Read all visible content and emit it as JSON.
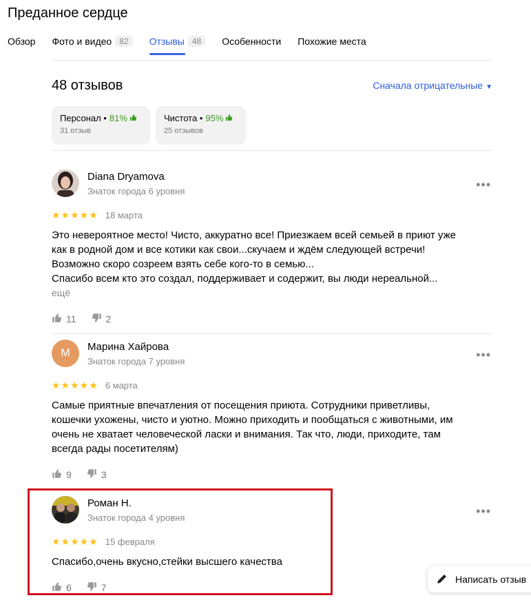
{
  "place": {
    "title": "Преданное сердце"
  },
  "tabs": [
    {
      "label": "Обзор",
      "count": ""
    },
    {
      "label": "Фото и видео",
      "count": "82"
    },
    {
      "label": "Отзывы",
      "count": "48"
    },
    {
      "label": "Особенности",
      "count": ""
    },
    {
      "label": "Похожие места",
      "count": ""
    }
  ],
  "reviews_header": {
    "count_label": "48 отзывов",
    "sort_label": "Сначала отрицательные"
  },
  "aspects": [
    {
      "name": "Персонал",
      "percent": "81%",
      "sub": "31 отзыв"
    },
    {
      "name": "Чистота",
      "percent": "95%",
      "sub": "25 отзывов"
    }
  ],
  "reviews": [
    {
      "author": "Diana Dryamova",
      "level": "Знаток города 6 уровня",
      "stars": "★★★★★",
      "date": "18 марта",
      "text_lines": [
        "Это невероятное место! Чисто, аккуратно все! Приезжаем всей семьей в приют уже",
        "как в родной дом и все котики как свои...скучаем и ждём следующей встречи!",
        "Возможно скоро созреем взять себе кого-то в семью...",
        "Спасибо всем кто это создал, поддерживает и содержит, вы люди нереальной..."
      ],
      "more_label": "ещё",
      "likes": "11",
      "dislikes": "2"
    },
    {
      "author": "Марина Хайрова",
      "avatar_letter": "М",
      "level": "Знаток города 7 уровня",
      "stars": "★★★★★",
      "date": "6 марта",
      "text_lines": [
        "Самые приятные впечатления от посещения приюта. Сотрудники приветливы,",
        "кошечки ухожены, чисто и уютно. Можно приходить и пообщаться с животными, им",
        "очень не хватает человеческой ласки и внимания. Так что, люди, приходите, там",
        "всегда рады посетителям)"
      ],
      "likes": "9",
      "dislikes": "3"
    },
    {
      "author": "Роман Н.",
      "level": "Знаток города 4 уровня",
      "stars": "★★★★★",
      "date": "15 февраля",
      "text_lines": [
        "Спасибо,очень вкусно,стейки высшего качества"
      ],
      "likes": "6",
      "dislikes": "7"
    }
  ],
  "write_review_label": "Написать отзыв",
  "colors": {
    "accent": "#2e5bdc",
    "star": "#fcc21b",
    "positive": "#3a9a1c",
    "highlight": "#d0121e",
    "letter_avatar": "#e59a5f"
  },
  "icons": {
    "more": "more-dots-icon",
    "like": "thumbs-up-icon",
    "dislike": "thumbs-down-icon",
    "write": "pencil-icon"
  }
}
